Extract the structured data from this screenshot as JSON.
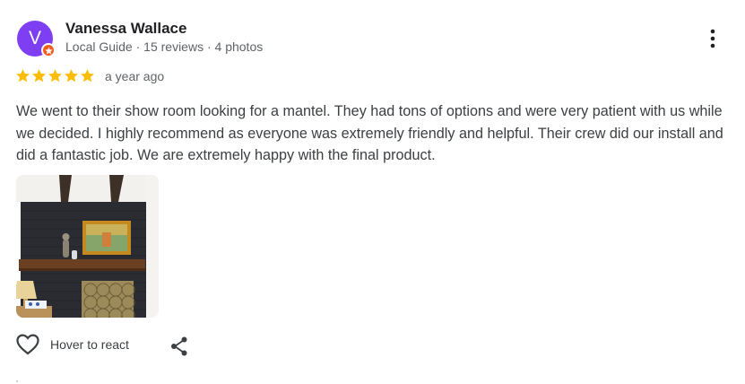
{
  "reviewer": {
    "initial": "V",
    "name": "Vanessa Wallace",
    "info": "Local Guide · 15 reviews · 4 photos",
    "avatar_color": "#7e3ff2",
    "badge_color": "#f25c1c"
  },
  "review": {
    "rating": 5,
    "time": "a year ago",
    "star_color": "#fbbc04",
    "text": "We went to their show room looking for a mantel. They had tons of options and were very patient with us while we decided. I highly recommend as everyone was extremely friendly and helpful. Their crew did our install and did a fantastic job. We are extremely happy with the final product."
  },
  "photo": {
    "icon": "fireplace-photo"
  },
  "actions": {
    "react_label": "Hover to react",
    "react_icon": "heart-outline-icon",
    "share_icon": "share-icon",
    "more_icon": "more-vert-icon"
  }
}
